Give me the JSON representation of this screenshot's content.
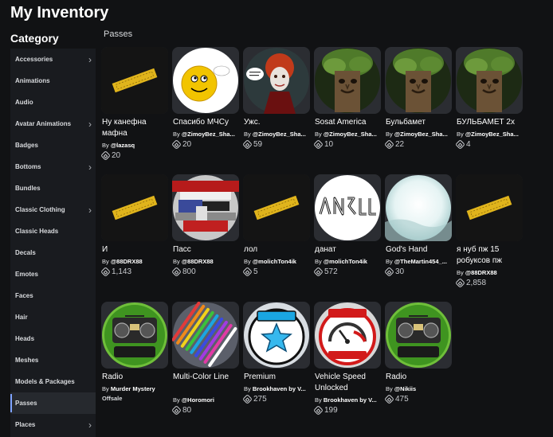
{
  "header": {
    "title": "My Inventory",
    "category_heading": "Category"
  },
  "sidebar": {
    "items": [
      {
        "label": "Accessories",
        "chevron": true,
        "active": false
      },
      {
        "label": "Animations",
        "chevron": false,
        "active": false
      },
      {
        "label": "Audio",
        "chevron": false,
        "active": false
      },
      {
        "label": "Avatar Animations",
        "chevron": true,
        "active": false
      },
      {
        "label": "Badges",
        "chevron": false,
        "active": false
      },
      {
        "label": "Bottoms",
        "chevron": true,
        "active": false
      },
      {
        "label": "Bundles",
        "chevron": false,
        "active": false
      },
      {
        "label": "Classic Clothing",
        "chevron": true,
        "active": false
      },
      {
        "label": "Classic Heads",
        "chevron": false,
        "active": false
      },
      {
        "label": "Decals",
        "chevron": false,
        "active": false
      },
      {
        "label": "Emotes",
        "chevron": false,
        "active": false
      },
      {
        "label": "Faces",
        "chevron": false,
        "active": false
      },
      {
        "label": "Hair",
        "chevron": false,
        "active": false
      },
      {
        "label": "Heads",
        "chevron": false,
        "active": false
      },
      {
        "label": "Meshes",
        "chevron": false,
        "active": false
      },
      {
        "label": "Models & Packages",
        "chevron": false,
        "active": false
      },
      {
        "label": "Passes",
        "chevron": false,
        "active": true
      },
      {
        "label": "Places",
        "chevron": true,
        "active": false
      }
    ]
  },
  "main": {
    "section_title": "Passes",
    "items": [
      {
        "name": "Ну канефна мафна",
        "by": "By",
        "creator": "@lazasq",
        "price": "20",
        "thumb": "ticket-image"
      },
      {
        "name": "Спасибо МЧСу",
        "by": "By",
        "creator": "@ZimoyBez_Sha...",
        "price": "20",
        "thumb": "smiley-image"
      },
      {
        "name": "Ужс.",
        "by": "By",
        "creator": "@ZimoyBez_Sha...",
        "price": "59",
        "thumb": "queen-meme-image"
      },
      {
        "name": "Sosat America",
        "by": "By",
        "creator": "@ZimoyBez_Sha...",
        "price": "10",
        "thumb": "tree-face-image"
      },
      {
        "name": "Бульбамет",
        "by": "By",
        "creator": "@ZimoyBez_Sha...",
        "price": "22",
        "thumb": "tree-face-image"
      },
      {
        "name": "БУЛЬБАМЕТ 2x",
        "by": "By",
        "creator": "@ZimoyBez_Sha...",
        "price": "4",
        "thumb": "tree-face-image"
      },
      {
        "name": "И",
        "by": "By",
        "creator": "@88DRX88",
        "price": "1,143",
        "thumb": "ticket-image"
      },
      {
        "name": "Пасс",
        "by": "By",
        "creator": "@88DRX88",
        "price": "800",
        "thumb": "glitch-photo-image"
      },
      {
        "name": "лол",
        "by": "By",
        "creator": "@molichTon4ik",
        "price": "5",
        "thumb": "ticket-image"
      },
      {
        "name": "данат",
        "by": "By",
        "creator": "@molichTon4ik",
        "price": "572",
        "thumb": "graffiti-image"
      },
      {
        "name": "God's Hand",
        "by": "By",
        "creator": "@TheMartin454_...",
        "price": "30",
        "thumb": "light-glow-image"
      },
      {
        "name": "я нуб пж 15 робуксов пж",
        "by": "By",
        "creator": "@88DRX88",
        "price": "2,858",
        "thumb": "ticket-image"
      },
      {
        "name": "Radio",
        "by": "By",
        "creator": "Murder Mystery",
        "offsale": "Offsale",
        "thumb": "radio-image"
      },
      {
        "name": "Multi-Color Line",
        "by": "By",
        "creator": "@Horomori",
        "price": "80",
        "thumb": "color-lines-image"
      },
      {
        "name": "Premium",
        "by": "By",
        "creator": "Brookhaven by V...",
        "price": "275",
        "thumb": "premium-star-image"
      },
      {
        "name": "Vehicle Speed Unlocked",
        "by": "By",
        "creator": "Brookhaven by V...",
        "price": "199",
        "thumb": "speedometer-image"
      },
      {
        "name": "Radio",
        "by": "By",
        "creator": "@Nikiis",
        "price": "475",
        "thumb": "radio-image"
      }
    ]
  },
  "colors": {
    "background": "#111214",
    "sidebar": "#191b1f",
    "card": "#2b2d32",
    "active_indicator": "#7fa4ff",
    "text": "#ffffff",
    "muted": "#c9cbcf"
  },
  "icons": {
    "currency": "robux-icon",
    "chevron": "chevron-right-icon"
  }
}
